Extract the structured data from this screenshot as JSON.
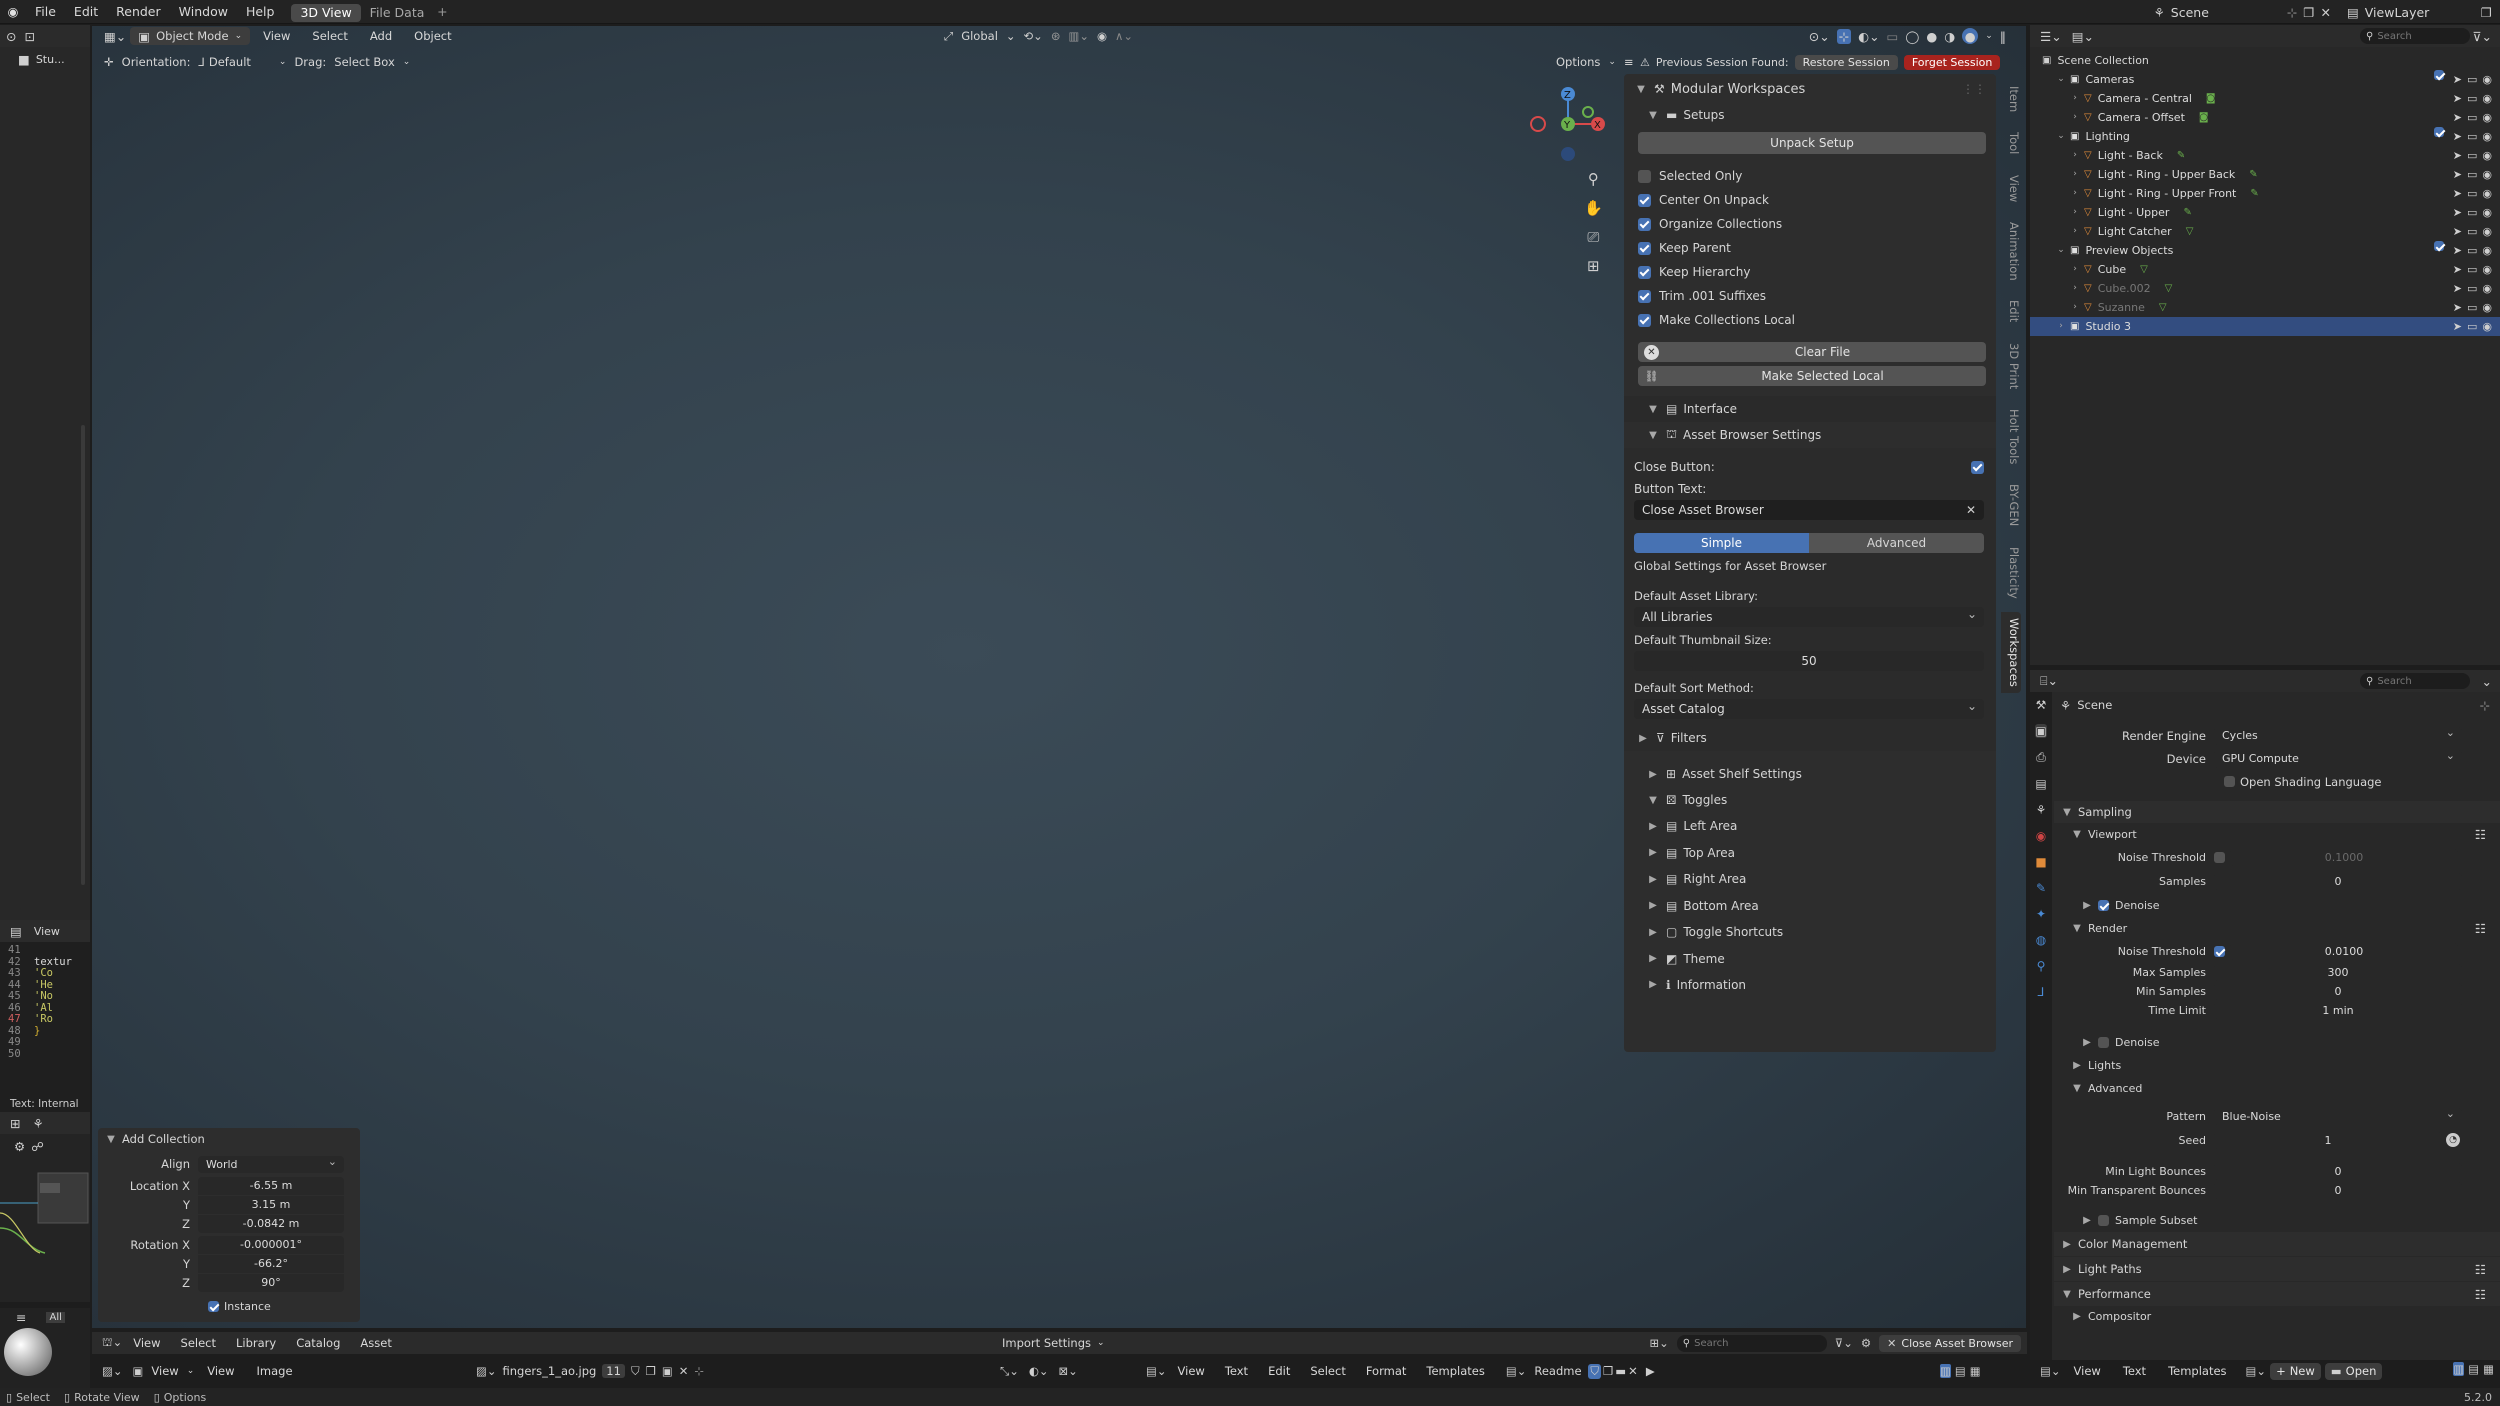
{
  "topbar": {
    "menus": [
      "File",
      "Edit",
      "Render",
      "Window",
      "Help"
    ],
    "tabs": [
      "3D View",
      "File Data"
    ],
    "scene": "Scene",
    "view_layer": "ViewLayer"
  },
  "view3d": {
    "mode": "Object Mode",
    "menus": [
      "View",
      "Select",
      "Add",
      "Object"
    ],
    "transform": "Global",
    "orientation_label": "Orientation:",
    "orientation_value": "Default",
    "drag_label": "Drag:",
    "drag_value": "Select Box",
    "options": "Options",
    "left_tool": "Stu..."
  },
  "session": {
    "notice": "Previous Session Found:",
    "restore": "Restore Session",
    "forget": "Forget Session"
  },
  "sidebar": {
    "title": "Modular Workspaces",
    "setups": "Setups",
    "unpack": "Unpack Setup",
    "options": [
      {
        "label": "Selected Only",
        "checked": false
      },
      {
        "label": "Center On Unpack",
        "checked": true
      },
      {
        "label": "Organize Collections",
        "checked": true
      },
      {
        "label": "Keep Parent",
        "checked": true
      },
      {
        "label": "Keep Hierarchy",
        "checked": true
      },
      {
        "label": "Trim .001 Suffixes",
        "checked": true
      },
      {
        "label": "Make Collections Local",
        "checked": true
      }
    ],
    "clear_file": "Clear File",
    "make_local": "Make Selected Local",
    "interface": "Interface",
    "asset_browser_settings": "Asset Browser Settings",
    "close_button_label": "Close Button:",
    "button_text_label": "Button Text:",
    "button_text_value": "Close Asset Browser",
    "simple": "Simple",
    "advanced": "Advanced",
    "global_settings": "Global Settings for Asset Browser",
    "default_library_label": "Default Asset Library:",
    "default_library_value": "All Libraries",
    "thumb_label": "Default Thumbnail Size:",
    "thumb_value": "50",
    "sort_label": "Default Sort Method:",
    "sort_value": "Asset Catalog",
    "filters": "Filters",
    "asset_shelf": "Asset Shelf Settings",
    "toggles": "Toggles",
    "toggle_items": [
      "Left Area",
      "Top Area",
      "Right Area",
      "Bottom Area",
      "Toggle Shortcuts"
    ],
    "theme": "Theme",
    "information": "Information",
    "tabs": [
      "Item",
      "Tool",
      "View",
      "Animation",
      "Edit",
      "3D Print",
      "Holt Tools",
      "BY-GEN",
      "Plasticity",
      "Workspaces"
    ]
  },
  "outliner": {
    "search": "Search",
    "root": "Scene Collection",
    "rows": [
      {
        "name": "Cameras",
        "level": 1,
        "type": "col"
      },
      {
        "name": "Camera - Central",
        "level": 2,
        "type": "cam"
      },
      {
        "name": "Camera - Offset",
        "level": 2,
        "type": "cam"
      },
      {
        "name": "Lighting",
        "level": 1,
        "type": "col"
      },
      {
        "name": "Light - Back",
        "level": 2,
        "type": "light"
      },
      {
        "name": "Light - Ring - Upper Back",
        "level": 2,
        "type": "light"
      },
      {
        "name": "Light - Ring - Upper Front",
        "level": 2,
        "type": "light"
      },
      {
        "name": "Light - Upper",
        "level": 2,
        "type": "light"
      },
      {
        "name": "Light Catcher",
        "level": 2,
        "type": "mesh"
      },
      {
        "name": "Preview Objects",
        "level": 1,
        "type": "col"
      },
      {
        "name": "Cube",
        "level": 2,
        "type": "mesh"
      },
      {
        "name": "Cube.002",
        "level": 2,
        "type": "mesh",
        "dim": true
      },
      {
        "name": "Suzanne",
        "level": 2,
        "type": "mesh",
        "dim": true
      },
      {
        "name": "Studio 3",
        "level": 1,
        "type": "col",
        "selected": true
      }
    ]
  },
  "properties": {
    "search": "Search",
    "scene": "Scene",
    "render_engine_label": "Render Engine",
    "render_engine": "Cycles",
    "device_label": "Device",
    "device": "GPU Compute",
    "osl": "Open Shading Language",
    "sampling": "Sampling",
    "viewport": "Viewport",
    "noise_threshold": "Noise Threshold",
    "vp_noise": "0.1000",
    "samples": "Samples",
    "vp_samples": "0",
    "denoise": "Denoise",
    "render": "Render",
    "r_noise": "0.0100",
    "max_samples": "Max Samples",
    "max_samples_v": "300",
    "min_samples": "Min Samples",
    "min_samples_v": "0",
    "time_limit": "Time Limit",
    "time_limit_v": "1 min",
    "lights": "Lights",
    "advanced": "Advanced",
    "pattern": "Pattern",
    "pattern_v": "Blue-Noise",
    "seed": "Seed",
    "seed_v": "1",
    "min_light": "Min Light Bounces",
    "min_light_v": "0",
    "min_transp": "Min Transparent Bounces",
    "min_transp_v": "0",
    "sample_subset": "Sample Subset",
    "color_mgmt": "Color Management",
    "light_paths": "Light Paths",
    "performance": "Performance",
    "compositor": "Compositor"
  },
  "add_collection": {
    "title": "Add Collection",
    "align_label": "Align",
    "align": "World",
    "loc_label": "Location X",
    "loc_x": "-6.55 m",
    "loc_y": "3.15 m",
    "loc_z": "-0.0842 m",
    "rot_label": "Rotation X",
    "rot_x": "-0.000001°",
    "rot_y": "-66.2°",
    "rot_z": "90°",
    "y": "Y",
    "z": "Z",
    "instance": "Instance"
  },
  "asset_bar": {
    "menus": [
      "View",
      "Select",
      "Library",
      "Catalog",
      "Asset"
    ],
    "import": "Import Settings",
    "search": "Search",
    "close": "Close Asset Browser"
  },
  "image_bar": {
    "menus": [
      "View",
      "View",
      "Image"
    ],
    "image": "fingers_1_ao.jpg",
    "users": "11"
  },
  "text_bar": {
    "menus": [
      "View",
      "Text",
      "Edit",
      "Select",
      "Format",
      "Templates"
    ],
    "file": "Readme"
  },
  "right_bar": {
    "menus": [
      "View",
      "Text",
      "Templates"
    ],
    "new": "New",
    "open": "Open"
  },
  "left_editor": {
    "view": "View",
    "lines": [
      "41",
      "42",
      "43",
      "44",
      "45",
      "46",
      "47",
      "48",
      "49",
      "50"
    ],
    "code": [
      "",
      "textur",
      "   'Co",
      "   'He",
      "   'No",
      "   'Al",
      "   'Ro",
      "}",
      "",
      ""
    ],
    "footer": "Text: Internal",
    "all": "All"
  },
  "status": {
    "select": "Select",
    "rotate": "Rotate View",
    "options": "Options",
    "version": "5.2.0"
  }
}
